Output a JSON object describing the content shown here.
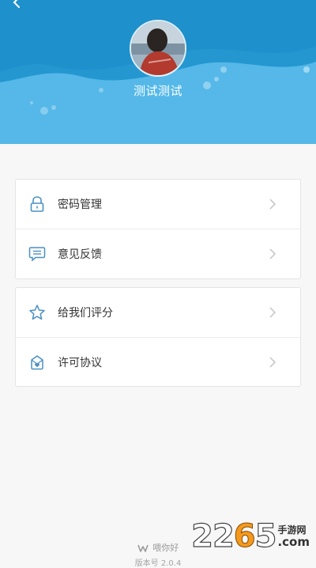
{
  "header": {
    "username": "测试测试",
    "colors": {
      "background": "#4fb3e4",
      "wave": "#2a9ad2"
    }
  },
  "menu_groups": [
    {
      "items": [
        {
          "label": "密码管理",
          "icon": "lock-icon"
        },
        {
          "label": "意见反馈",
          "icon": "message-icon"
        }
      ]
    },
    {
      "items": [
        {
          "label": "给我们评分",
          "icon": "star-icon"
        },
        {
          "label": "许可协议",
          "icon": "license-icon"
        }
      ]
    }
  ],
  "footer": {
    "brand": "喂你好",
    "version": "版本号 2.0.4"
  },
  "watermark": {
    "number": "2265",
    "site_cn": "手游网",
    "site_en": ".com"
  },
  "colors": {
    "accent": "#4a90c2",
    "text": "#333333",
    "divider": "#ececec"
  }
}
